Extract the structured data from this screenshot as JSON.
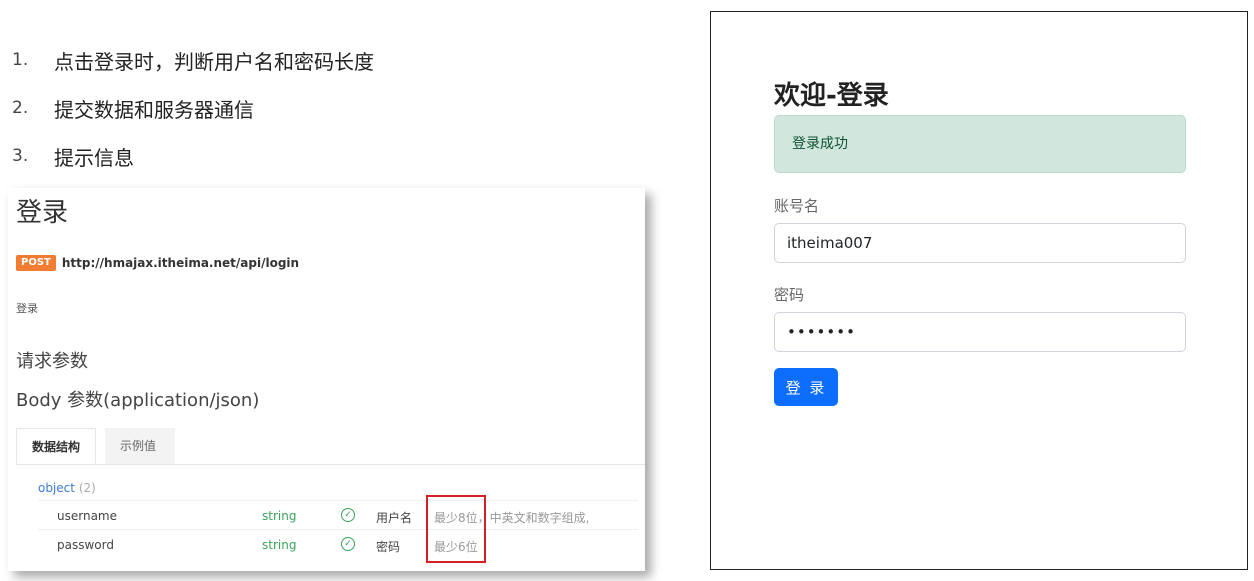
{
  "steps": [
    {
      "num": "1.",
      "text": "点击登录时，判断用户名和密码长度"
    },
    {
      "num": "2.",
      "text": "提交数据和服务器通信"
    },
    {
      "num": "3.",
      "text": "提示信息"
    }
  ],
  "doc": {
    "title": "登录",
    "method": "POST",
    "url": "http://hmajax.itheima.net/api/login",
    "description": "登录",
    "request_params_heading": "请求参数",
    "body_heading": "Body 参数(application/json)",
    "tabs": [
      "数据结构",
      "示例值"
    ],
    "object_label": "object",
    "object_count": "(2)",
    "fields": [
      {
        "name": "username",
        "type": "string",
        "desc": "用户名",
        "rule": "最少8位，中英文和数字组成,"
      },
      {
        "name": "password",
        "type": "string",
        "desc": "密码",
        "rule": "最少6位"
      }
    ],
    "accent_color": "#f07d31"
  },
  "login": {
    "title": "欢迎-登录",
    "alert": "登录成功",
    "username_label": "账号名",
    "username_value": "itheima007",
    "password_label": "密码",
    "password_value": "•••••••",
    "submit_label": "登 录",
    "success_color": "#d1e7dd",
    "button_color": "#0d6efd"
  }
}
